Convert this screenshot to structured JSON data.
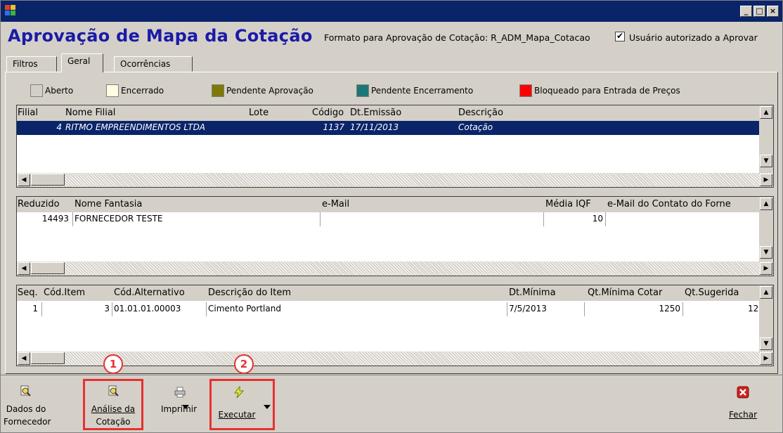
{
  "window": {
    "minimize": "_",
    "maximize": "□",
    "close": "×"
  },
  "header": {
    "title": "Aprovação de Mapa da Cotação",
    "format_label": "Formato para Aprovação de Cotação: R_ADM_Mapa_Cotacao",
    "authorized_checked": "✔",
    "authorized_label": "Usuário autorizado a Aprovar"
  },
  "tabs": [
    {
      "label": "Filtros"
    },
    {
      "label": "Geral"
    },
    {
      "label": "Ocorrências"
    }
  ],
  "legend": [
    {
      "label": "Aberto",
      "color": "#d4d0c8"
    },
    {
      "label": "Encerrado",
      "color": "#fffbe0"
    },
    {
      "label": "Pendente Aprovação",
      "color": "#7d7a08"
    },
    {
      "label": "Pendente Encerramento",
      "color": "#1c7878"
    },
    {
      "label": "Bloqueado para Entrada de Preços",
      "color": "#ff0000"
    }
  ],
  "grid1": {
    "headers": [
      "Filial",
      "Nome Filial",
      "Lote",
      "Código",
      "Dt.Emissão",
      "Descrição"
    ],
    "rows": [
      {
        "filial": "4",
        "nome": "RITMO EMPREENDIMENTOS LTDA",
        "lote": "",
        "codigo": "1137",
        "dt": "17/11/2013",
        "descricao": "Cotação"
      }
    ]
  },
  "grid2": {
    "headers": [
      "Reduzido",
      "Nome Fantasia",
      "e-Mail",
      "Média IQF",
      "e-Mail do Contato do Forne"
    ],
    "rows": [
      {
        "reduzido": "14493",
        "nome": "FORNECEDOR TESTE",
        "email": "",
        "iqf": "10",
        "contato": ""
      }
    ]
  },
  "grid3": {
    "headers": [
      "Seq.",
      "Cód.Item",
      "Cód.Alternativo",
      "Descrição do Item",
      "Dt.Mínima",
      "Qt.Mínima Cotar",
      "Qt.Sugerida"
    ],
    "rows": [
      {
        "seq": "1",
        "item": "3",
        "alt": "01.01.01.00003",
        "desc": "Cimento Portland",
        "dt": "7/5/2013",
        "qtmin": "1250",
        "qtsug": "12"
      }
    ]
  },
  "toolbar": {
    "dados_line1": "Dados do",
    "dados_line2": "Fornecedor",
    "analise_line1": "Análise da",
    "analise_line2": "Cotação",
    "imprimir": "Imprimir",
    "executar": "Executar",
    "fechar": "Fechar"
  },
  "annotations": {
    "one": "1",
    "two": "2",
    "color": "#e53131"
  }
}
